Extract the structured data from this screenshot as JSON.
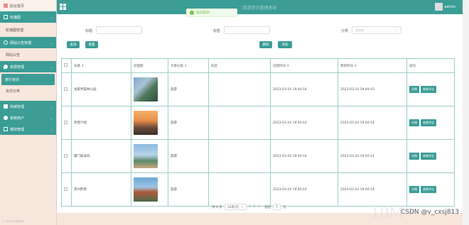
{
  "sidebar": {
    "top": "后台首页",
    "cat1": "轮播图",
    "sub1": "轮播图管理",
    "cat2": "网站公告管理",
    "sub2": "网站公告",
    "cat3": "资源管理",
    "sub3a": "旅行资讯",
    "sub3b": "资讯分类",
    "cat4": "商城管理",
    "cat5": "系统用户",
    "cat6": "模块管理",
    "footer": "© 2024 ZHANGYI"
  },
  "header": {
    "title": "旅游资讯管理系统",
    "user": "admin"
  },
  "toast": "操作成功!",
  "search": {
    "title_label": "标题",
    "tag_label": "标签",
    "category_label": "分类",
    "category_placeholder": "请选择"
  },
  "buttons": {
    "search": "查询",
    "reset": "重置",
    "delete": "删除",
    "add": "添加"
  },
  "table": {
    "headers": [
      "标题",
      "封面图",
      "文章分类",
      "标签",
      "创建时间",
      "更新时间",
      "操作"
    ],
    "rows": [
      {
        "title": "张家界森林公园",
        "category": "旅游",
        "tags": "",
        "created": "2023-03-24 19:40:14",
        "updated": "2023-03-24 19:49:43"
      },
      {
        "title": "赤壁介绍",
        "category": "旅游",
        "tags": "",
        "created": "2023-03-24 19:40:14",
        "updated": "2023-03-24 19:40:14"
      },
      {
        "title": "厦门鼓浪屿",
        "category": "旅游",
        "tags": "",
        "created": "2023-03-24 19:40:14",
        "updated": "2023-03-24 19:40:14"
      },
      {
        "title": "贵州黔南",
        "category": "旅游",
        "tags": "",
        "created": "2023-03-24 19:40:14",
        "updated": "2023-03-24 19:40:14"
      }
    ],
    "action_detail": "详情",
    "action_comment": "查看评论"
  },
  "pager": {
    "total": "共 4 条",
    "page_size": "10条/页",
    "prev": "<",
    "page": "1",
    "next": ">",
    "goto": "前往",
    "goto_val": "1",
    "page_unit": "页"
  },
  "watermark": {
    "faint": "10M",
    "csdn": "CSDN @v_cxsj813"
  },
  "colors": {
    "primary": "#3b9d96",
    "sidebar_bg": "#f6e6dc"
  }
}
